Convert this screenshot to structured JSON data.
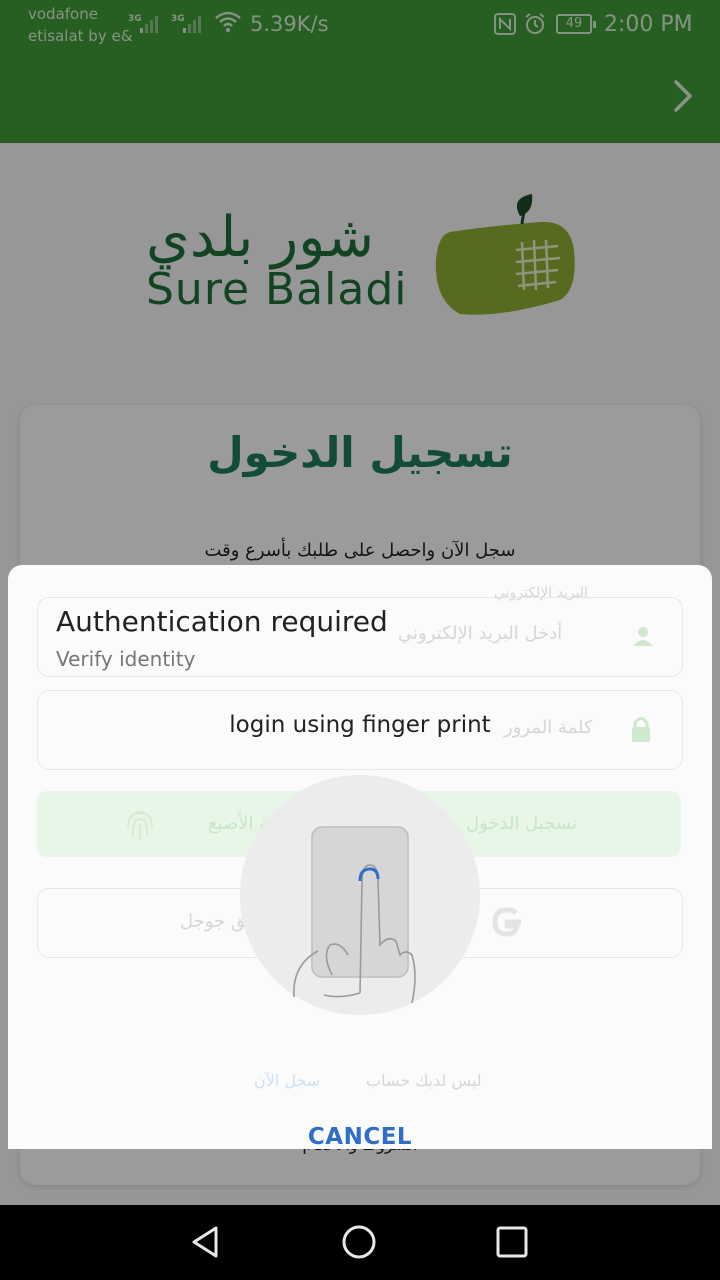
{
  "status_bar": {
    "carrier1": "vodafone",
    "carrier2": "etisalat by e&",
    "sig1_label": "3G",
    "sig2_label": "3G",
    "speed": "5.39K/s",
    "battery": "49",
    "time": "2:00 PM"
  },
  "logo": {
    "arabic": "شور بلدي",
    "english": "Sure Baladi"
  },
  "login_card": {
    "title": "تسجيل الدخول",
    "subtitle": "سجل الآن واحصل على طلبك بأسرع وقت",
    "email_label": "البريد الإلكتروني",
    "email_placeholder": "أدخل البريد الإلكتروني",
    "password_placeholder": "كلمة المرور",
    "fingerprint_button": "بصمة الأصبع",
    "login_button": "تسجيل الدخول",
    "google_button": "تسجيل الدخول عن طريق جوجل",
    "no_account": "ليس لديك حساب",
    "register_link": "سجل الآن",
    "terms": "الشروط والأحكام"
  },
  "dialog": {
    "title": "Authentication required",
    "subtitle": "Verify identity",
    "description": "login using finger print",
    "cancel": "CANCEL"
  },
  "colors": {
    "brand_green": "#3f9a37",
    "dark_green": "#1e6f3a",
    "accent_blue": "#2f6fc7"
  }
}
